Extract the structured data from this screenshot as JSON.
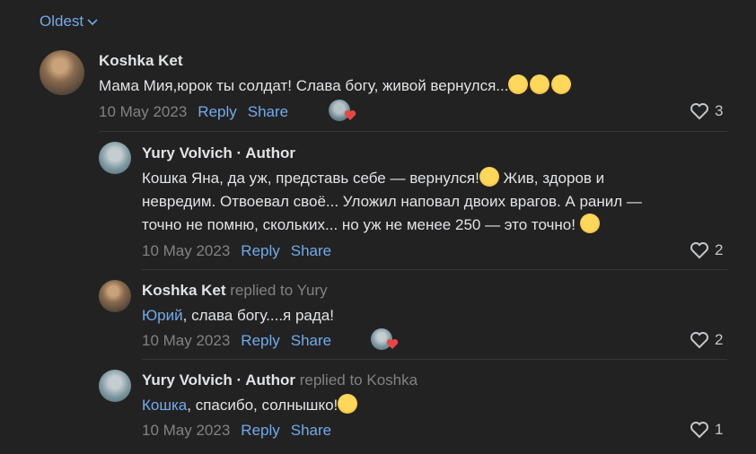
{
  "sort": {
    "label": "Oldest"
  },
  "comments": [
    {
      "author": "Koshka Ket",
      "replied": "",
      "text": "Мама Мия,юрок ты солдат! Слава богу, живой вернулся...",
      "date": "10 May 2023",
      "reply_label": "Reply",
      "share_label": "Share",
      "likes": "3"
    },
    {
      "author": "Yury Volvich · Author",
      "replied": "",
      "text_line1": "Кошка Яна, да уж, представь себе — вернулся!",
      "text_line1b": " Жив, здоров и",
      "text_line2": "невредим. Отвоевал своё... Уложил наповал двоих врагов. А ранил —",
      "text_line3": "точно не помню, скольких... но уж не менее 250 — это точно!",
      "date": "10 May 2023",
      "reply_label": "Reply",
      "share_label": "Share",
      "likes": "2"
    },
    {
      "author": "Koshka Ket",
      "replied": "replied to Yury",
      "mention": "Юрий",
      "text": ", слава богу....я рада!",
      "date": "10 May 2023",
      "reply_label": "Reply",
      "share_label": "Share",
      "likes": "2"
    },
    {
      "author": "Yury Volvich · Author",
      "replied": "replied to Koshka",
      "mention": "Кошка",
      "text": ", спасибо, солнышко!",
      "date": "10 May 2023",
      "reply_label": "Reply",
      "share_label": "Share",
      "likes": "1"
    }
  ],
  "colors": {
    "background": "#222222",
    "link": "#71aaeb",
    "muted": "#828282",
    "text": "#e1e3e6",
    "like_heart": "#e64646"
  }
}
